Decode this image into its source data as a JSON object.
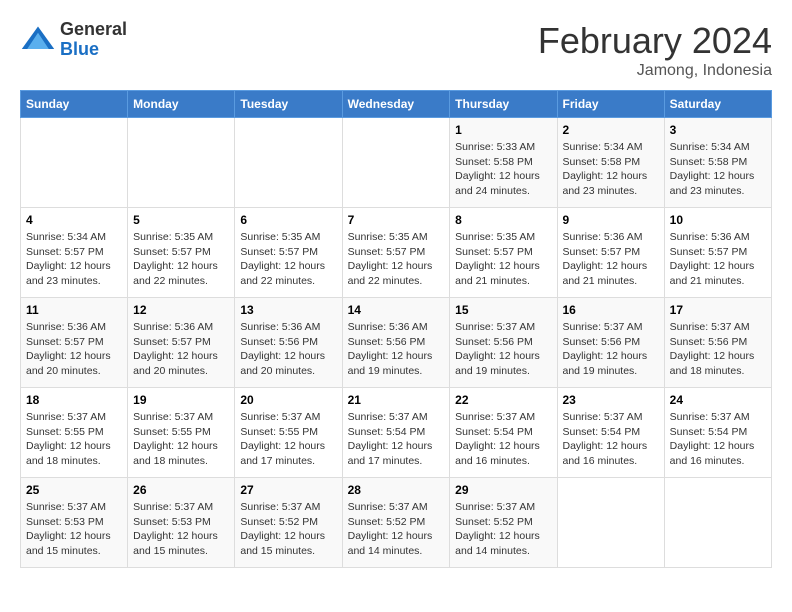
{
  "logo": {
    "general": "General",
    "blue": "Blue"
  },
  "header": {
    "month_year": "February 2024",
    "location": "Jamong, Indonesia"
  },
  "weekdays": [
    "Sunday",
    "Monday",
    "Tuesday",
    "Wednesday",
    "Thursday",
    "Friday",
    "Saturday"
  ],
  "weeks": [
    [
      {
        "day": "",
        "info": ""
      },
      {
        "day": "",
        "info": ""
      },
      {
        "day": "",
        "info": ""
      },
      {
        "day": "",
        "info": ""
      },
      {
        "day": "1",
        "info": "Sunrise: 5:33 AM\nSunset: 5:58 PM\nDaylight: 12 hours\nand 24 minutes."
      },
      {
        "day": "2",
        "info": "Sunrise: 5:34 AM\nSunset: 5:58 PM\nDaylight: 12 hours\nand 23 minutes."
      },
      {
        "day": "3",
        "info": "Sunrise: 5:34 AM\nSunset: 5:58 PM\nDaylight: 12 hours\nand 23 minutes."
      }
    ],
    [
      {
        "day": "4",
        "info": "Sunrise: 5:34 AM\nSunset: 5:57 PM\nDaylight: 12 hours\nand 23 minutes."
      },
      {
        "day": "5",
        "info": "Sunrise: 5:35 AM\nSunset: 5:57 PM\nDaylight: 12 hours\nand 22 minutes."
      },
      {
        "day": "6",
        "info": "Sunrise: 5:35 AM\nSunset: 5:57 PM\nDaylight: 12 hours\nand 22 minutes."
      },
      {
        "day": "7",
        "info": "Sunrise: 5:35 AM\nSunset: 5:57 PM\nDaylight: 12 hours\nand 22 minutes."
      },
      {
        "day": "8",
        "info": "Sunrise: 5:35 AM\nSunset: 5:57 PM\nDaylight: 12 hours\nand 21 minutes."
      },
      {
        "day": "9",
        "info": "Sunrise: 5:36 AM\nSunset: 5:57 PM\nDaylight: 12 hours\nand 21 minutes."
      },
      {
        "day": "10",
        "info": "Sunrise: 5:36 AM\nSunset: 5:57 PM\nDaylight: 12 hours\nand 21 minutes."
      }
    ],
    [
      {
        "day": "11",
        "info": "Sunrise: 5:36 AM\nSunset: 5:57 PM\nDaylight: 12 hours\nand 20 minutes."
      },
      {
        "day": "12",
        "info": "Sunrise: 5:36 AM\nSunset: 5:57 PM\nDaylight: 12 hours\nand 20 minutes."
      },
      {
        "day": "13",
        "info": "Sunrise: 5:36 AM\nSunset: 5:56 PM\nDaylight: 12 hours\nand 20 minutes."
      },
      {
        "day": "14",
        "info": "Sunrise: 5:36 AM\nSunset: 5:56 PM\nDaylight: 12 hours\nand 19 minutes."
      },
      {
        "day": "15",
        "info": "Sunrise: 5:37 AM\nSunset: 5:56 PM\nDaylight: 12 hours\nand 19 minutes."
      },
      {
        "day": "16",
        "info": "Sunrise: 5:37 AM\nSunset: 5:56 PM\nDaylight: 12 hours\nand 19 minutes."
      },
      {
        "day": "17",
        "info": "Sunrise: 5:37 AM\nSunset: 5:56 PM\nDaylight: 12 hours\nand 18 minutes."
      }
    ],
    [
      {
        "day": "18",
        "info": "Sunrise: 5:37 AM\nSunset: 5:55 PM\nDaylight: 12 hours\nand 18 minutes."
      },
      {
        "day": "19",
        "info": "Sunrise: 5:37 AM\nSunset: 5:55 PM\nDaylight: 12 hours\nand 18 minutes."
      },
      {
        "day": "20",
        "info": "Sunrise: 5:37 AM\nSunset: 5:55 PM\nDaylight: 12 hours\nand 17 minutes."
      },
      {
        "day": "21",
        "info": "Sunrise: 5:37 AM\nSunset: 5:54 PM\nDaylight: 12 hours\nand 17 minutes."
      },
      {
        "day": "22",
        "info": "Sunrise: 5:37 AM\nSunset: 5:54 PM\nDaylight: 12 hours\nand 16 minutes."
      },
      {
        "day": "23",
        "info": "Sunrise: 5:37 AM\nSunset: 5:54 PM\nDaylight: 12 hours\nand 16 minutes."
      },
      {
        "day": "24",
        "info": "Sunrise: 5:37 AM\nSunset: 5:54 PM\nDaylight: 12 hours\nand 16 minutes."
      }
    ],
    [
      {
        "day": "25",
        "info": "Sunrise: 5:37 AM\nSunset: 5:53 PM\nDaylight: 12 hours\nand 15 minutes."
      },
      {
        "day": "26",
        "info": "Sunrise: 5:37 AM\nSunset: 5:53 PM\nDaylight: 12 hours\nand 15 minutes."
      },
      {
        "day": "27",
        "info": "Sunrise: 5:37 AM\nSunset: 5:52 PM\nDaylight: 12 hours\nand 15 minutes."
      },
      {
        "day": "28",
        "info": "Sunrise: 5:37 AM\nSunset: 5:52 PM\nDaylight: 12 hours\nand 14 minutes."
      },
      {
        "day": "29",
        "info": "Sunrise: 5:37 AM\nSunset: 5:52 PM\nDaylight: 12 hours\nand 14 minutes."
      },
      {
        "day": "",
        "info": ""
      },
      {
        "day": "",
        "info": ""
      }
    ]
  ]
}
